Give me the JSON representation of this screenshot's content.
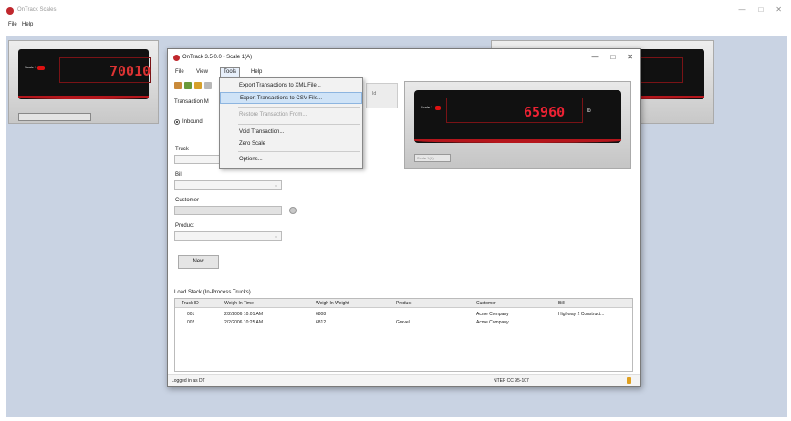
{
  "outer": {
    "title": "OnTrack Scales",
    "menu": [
      "File",
      "Help"
    ],
    "controls": [
      "—",
      "□",
      "✕"
    ]
  },
  "bg_scale_left": {
    "readout": "70010",
    "label": "Scale 1"
  },
  "bg_scale_right": {
    "readout": ""
  },
  "inner": {
    "title": "OnTrack 3.5.0.0 - Scale 1(A)",
    "controls": [
      "—",
      "□",
      "✕"
    ],
    "menu": [
      "File",
      "View",
      "Tools",
      "Help"
    ],
    "transaction_label": "Transaction M",
    "radio_label": "Inbound",
    "fields": {
      "truck": "Truck",
      "bill": "Bill",
      "customer": "Customer",
      "product": "Product"
    },
    "new_button": "New",
    "ghost_button": "Id",
    "scale": {
      "label": "Scale 1",
      "readout": "65960",
      "unit": "lb",
      "id_box": "Scale 1(A)"
    },
    "load_label": "Load Stack (In-Process Trucks)",
    "grid": {
      "headers": [
        "Truck ID",
        "Weigh In Time",
        "Weigh In Weight",
        "Product",
        "Customer",
        "Bill"
      ],
      "rows": [
        [
          "001",
          "2/2/2006 10:01 AM",
          "6808",
          "",
          "Acme Company",
          "Highway 2 Construct..."
        ],
        [
          "002",
          "2/2/2006 10:25 AM",
          "6812",
          "Gravel",
          "Acme Company",
          ""
        ]
      ]
    },
    "status_left": "Logged in as DT",
    "status_right": "NTEP CC 95-107"
  },
  "tools_dropdown": {
    "items": [
      {
        "label": "Export Transactions to XML File...",
        "highlighted": false,
        "disabled": false
      },
      {
        "label": "Export Transactions to CSV File...",
        "highlighted": true,
        "disabled": false
      },
      {
        "label": "Restore Transaction From...",
        "highlighted": false,
        "disabled": true
      },
      {
        "label": "Void Transaction...",
        "highlighted": false,
        "disabled": false
      },
      {
        "label": "Zero Scale",
        "highlighted": false,
        "disabled": false
      },
      {
        "label": "Options...",
        "highlighted": false,
        "disabled": false
      }
    ]
  },
  "colors": {
    "brand_red": "#c0272d",
    "readout_red": "#e22333",
    "desktop_blue": "#c9d3e3",
    "highlight": "#cfe3f7"
  }
}
